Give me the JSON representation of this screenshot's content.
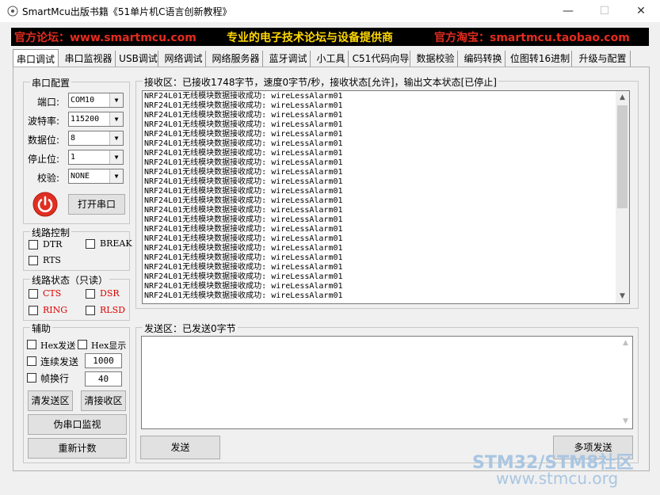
{
  "window": {
    "title": "SmartMcu出版书籍《51单片机C语言创新教程》",
    "min_glyph": "—",
    "max_glyph": "☐",
    "close_glyph": "✕"
  },
  "banner": {
    "left": "官方论坛：www.smartmcu.com",
    "center": "专业的电子技术论坛与设备提供商",
    "right": "官方淘宝：smartmcu.taobao.com"
  },
  "tabs": [
    "串口调试",
    "串口监视器",
    "USB调试",
    "网络调试",
    "网络服务器",
    "蓝牙调试",
    "小工具",
    "C51代码向导",
    "数据校验",
    "编码转换",
    "位图转16进制",
    "升级与配置"
  ],
  "serial_config": {
    "title": "串口配置",
    "fields": [
      {
        "label": "端口:",
        "value": "COM10"
      },
      {
        "label": "波特率:",
        "value": "115200"
      },
      {
        "label": "数据位:",
        "value": "8"
      },
      {
        "label": "停止位:",
        "value": "1"
      },
      {
        "label": "校验:",
        "value": "NONE"
      }
    ],
    "open_button": "打开串口",
    "dropdown_arrow": "▼"
  },
  "line_control": {
    "title": "线路控制",
    "dtr": "DTR",
    "break": "BREAK",
    "rts": "RTS"
  },
  "line_status": {
    "title": "线路状态（只读）",
    "cts": "CTS",
    "dsr": "DSR",
    "ring": "RING",
    "rlsd": "RLSD"
  },
  "assist": {
    "title": "辅助",
    "hex_send": "Hex发送",
    "hex_show": "Hex显示",
    "continuous_send": "连续发送",
    "continuous_value": "1000",
    "frame_wrap": "帧换行",
    "frame_value": "40",
    "clear_send": "清发送区",
    "clear_recv": "清接收区",
    "pseudo_monitor": "伪串口监视",
    "recount": "重新计数"
  },
  "receive": {
    "title": "接收区：已接收1748字节，速度0字节/秒，接收状态[允许]，输出文本状态[已停止]",
    "line": "NRF24L01无线模块数据接收成功: wireLessAlarm01",
    "line_count": 22
  },
  "send_area": {
    "title": "发送区：已发送0字节",
    "send_button": "发送",
    "multi_send_button": "多项发送"
  },
  "watermark": {
    "line1": "STM32/STM8社区",
    "line2": "www.stmcu.org"
  }
}
